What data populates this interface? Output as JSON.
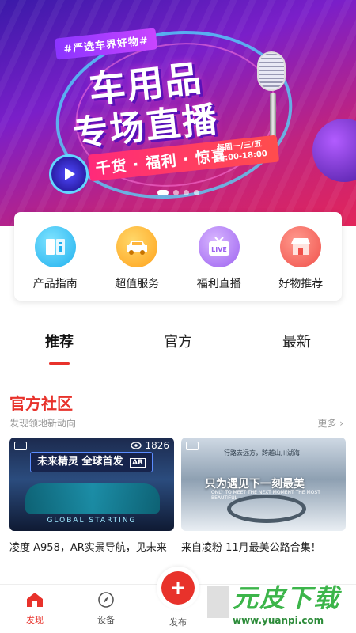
{
  "banner": {
    "tag": "#严选车界好物#",
    "title_line1": "车用品",
    "title_line2": "专场直播",
    "highlight": "千货 · 福利 · 惊喜",
    "schedule_days": "每周一/三/五",
    "schedule_time": "16:00-18:00",
    "carousel_total": 4,
    "carousel_active": 1
  },
  "services": [
    {
      "label": "产品指南",
      "icon": "book-icon"
    },
    {
      "label": "超值服务",
      "icon": "car-icon"
    },
    {
      "label": "福利直播",
      "icon": "live-tv-icon",
      "badge": "LIVE"
    },
    {
      "label": "好物推荐",
      "icon": "shop-icon"
    }
  ],
  "tabs": [
    {
      "label": "推荐",
      "active": true
    },
    {
      "label": "官方",
      "active": false
    },
    {
      "label": "最新",
      "active": false
    }
  ],
  "community": {
    "title": "官方社区",
    "subtitle": "发现领地新动向",
    "more": "更多",
    "posts": [
      {
        "headline": "未来精灵 全球首发",
        "badge": "AR",
        "views": "1826",
        "footer": "GLOBAL STARTING",
        "caption": "凌度 A958，AR实景导航，见未来"
      },
      {
        "headline": "只为遇见下一刻最美",
        "small": "行路去远方，跨越山川湖海",
        "en": "ONLY TO MEET THE NEXT MOMENT THE MOST BEAUTIFUL",
        "views": "",
        "caption": "来自凌粉 11月最美公路合集！"
      }
    ]
  },
  "nav": {
    "discover": "发现",
    "device": "设备",
    "publish": "发布"
  },
  "watermark": {
    "brand": "元皮下载",
    "url": "www.yuanpi.com"
  },
  "colors": {
    "accent": "#e8322b"
  }
}
